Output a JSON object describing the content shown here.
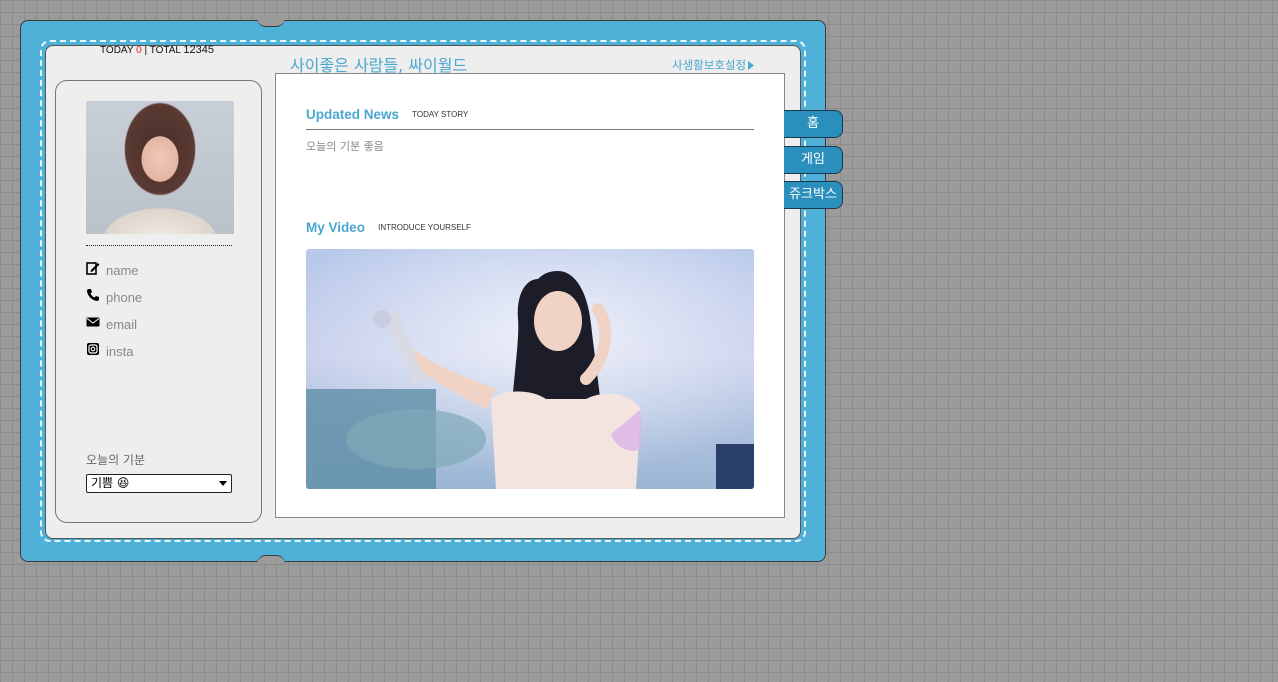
{
  "counter": {
    "today_label": "TODAY",
    "today_value": "0",
    "separator": "|",
    "total_label": "TOTAL",
    "total_value": "12345"
  },
  "header": {
    "site_title": "사이좋은 사람들, 싸이월드",
    "privacy_link": "사생활보호설정"
  },
  "profile": {
    "fields": [
      {
        "icon": "edit-icon",
        "label": "name"
      },
      {
        "icon": "phone-icon",
        "label": "phone"
      },
      {
        "icon": "email-icon",
        "label": "email"
      },
      {
        "icon": "instagram-icon",
        "label": "insta"
      }
    ],
    "mood_label": "오늘의 기분",
    "mood_selected": "기쁨 😆"
  },
  "news": {
    "title": "Updated News",
    "subtitle": "TODAY STORY",
    "items": [
      "오늘의 기분 좋음"
    ]
  },
  "video": {
    "title": "My Video",
    "subtitle": "INTRODUCE YOURSELF"
  },
  "tabs": [
    {
      "label": "홈"
    },
    {
      "label": "게임"
    },
    {
      "label": "쥬크박스"
    }
  ],
  "colors": {
    "frame": "#4fb0d8",
    "accent": "#4aa7cf",
    "tab": "#2b8fbd",
    "today_count": "#e0272b"
  }
}
